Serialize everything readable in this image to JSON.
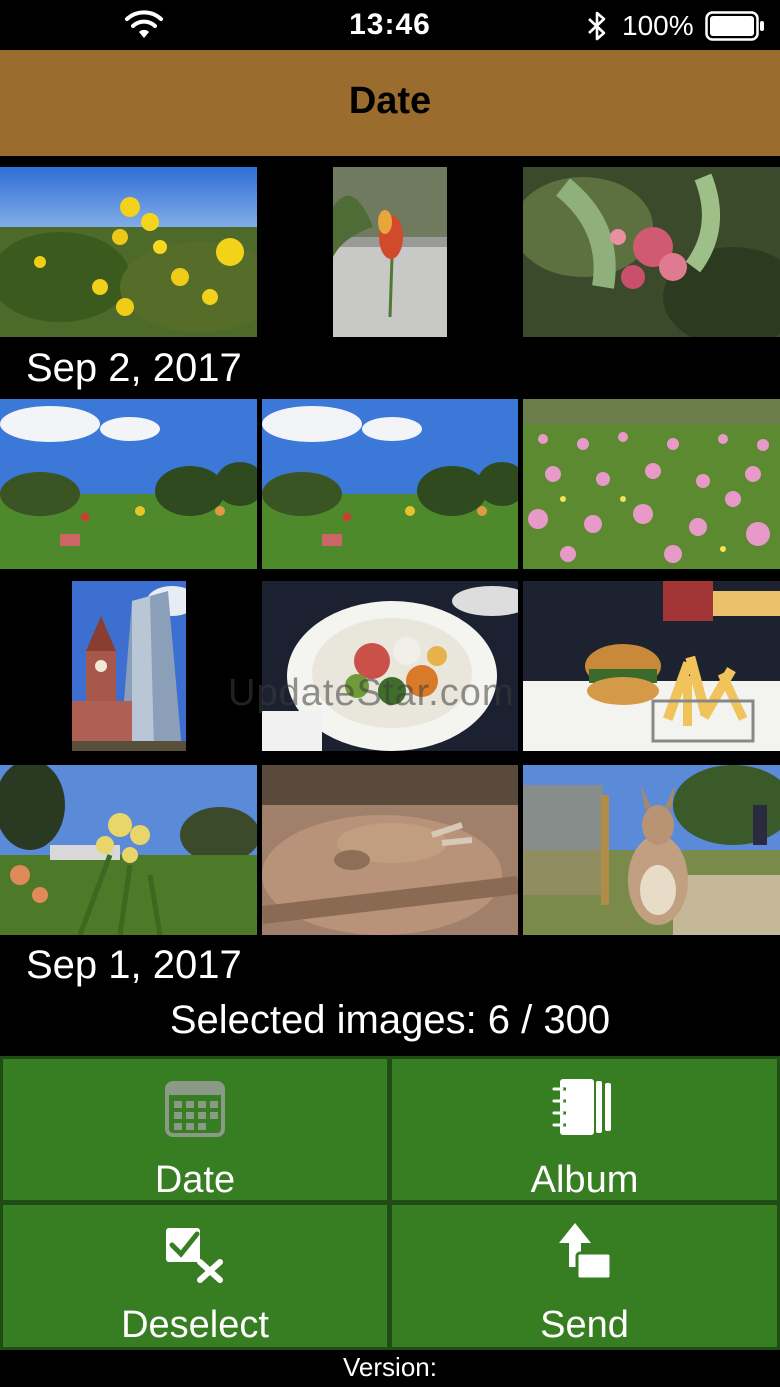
{
  "status_bar": {
    "time": "13:46",
    "battery_percent": "100%",
    "icons": [
      "wifi-icon",
      "bluetooth-icon",
      "battery-icon"
    ]
  },
  "nav": {
    "title": "Date"
  },
  "sections": [
    {
      "date": "Sep 2, 2017"
    },
    {
      "date": "Sep 1, 2017"
    }
  ],
  "photos": [
    {
      "subject": "yellow wildflowers under blue sky"
    },
    {
      "subject": "red kangaroo paw flower on gravel"
    },
    {
      "subject": "pink flowering shrub"
    },
    {
      "subject": "picnic on park lawn"
    },
    {
      "subject": "picnic on park lawn"
    },
    {
      "subject": "field of pink everlasting flowers"
    },
    {
      "subject": "town hall clock tower and skyscraper"
    },
    {
      "subject": "salad plate on table"
    },
    {
      "subject": "burger and fries on table"
    },
    {
      "subject": "grevillea flowers in park"
    },
    {
      "subject": "kangaroo lying on sand"
    },
    {
      "subject": "kangaroo standing on path"
    }
  ],
  "selection": {
    "text": "Selected images:  6 / 300"
  },
  "actions": [
    {
      "label": "Date",
      "icon": "calendar-icon"
    },
    {
      "label": "Album",
      "icon": "album-icon"
    },
    {
      "label": "Deselect",
      "icon": "deselect-icon"
    },
    {
      "label": "Send",
      "icon": "send-icon"
    }
  ],
  "footer": {
    "version_label": "Version:"
  },
  "watermark": "UpdateStar.com",
  "colors": {
    "nav_bar": "#9a6d2e",
    "action_button": "#377d22",
    "action_border": "#1f4d15",
    "background": "#000000"
  }
}
